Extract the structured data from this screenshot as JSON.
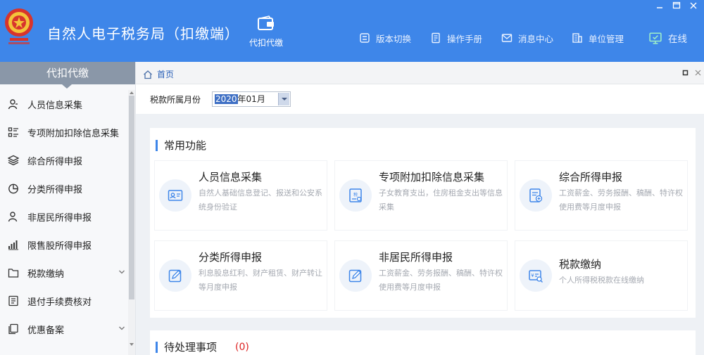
{
  "app": {
    "title": "自然人电子税务局（扣缴端）",
    "main_nav_label": "代扣代缴"
  },
  "header_menu": [
    {
      "label": "版本切换",
      "icon": "version-switch-icon"
    },
    {
      "label": "操作手册",
      "icon": "manual-icon"
    },
    {
      "label": "消息中心",
      "icon": "message-icon"
    },
    {
      "label": "单位管理",
      "icon": "company-icon"
    },
    {
      "label": "在线",
      "icon": "online-monitor-icon"
    }
  ],
  "sidebar": {
    "heading": "代扣代缴",
    "items": [
      {
        "label": "人员信息采集",
        "icon": "person-icon"
      },
      {
        "label": "专项附加扣除信息采集",
        "icon": "list-icon"
      },
      {
        "label": "综合所得申报",
        "icon": "layers-icon"
      },
      {
        "label": "分类所得申报",
        "icon": "pie-icon"
      },
      {
        "label": "非居民所得申报",
        "icon": "person-outline-icon"
      },
      {
        "label": "限售股所得申报",
        "icon": "bar-chart-icon"
      },
      {
        "label": "税款缴纳",
        "icon": "folder-icon"
      },
      {
        "label": "退付手续费核对",
        "icon": "document-icon"
      },
      {
        "label": "优惠备案",
        "icon": "copy-icon"
      }
    ]
  },
  "tabbar": {
    "home_label": "首页"
  },
  "filter": {
    "label": "税款所属月份",
    "value_year": "2020",
    "value_rest": "年01月"
  },
  "common": {
    "title": "常用功能",
    "cards": [
      {
        "title": "人员信息采集",
        "desc": "自然人基础信息登记、报送和公安系统身份验证",
        "icon": "id-card-icon"
      },
      {
        "title": "专项附加扣除信息采集",
        "desc": "子女教育支出，住房租金支出等信息采集",
        "icon": "tax-doc-icon"
      },
      {
        "title": "综合所得申报",
        "desc": "工资薪金、劳务报酬、稿酬、特许权使用费等月度申报",
        "icon": "report-add-icon"
      },
      {
        "title": "分类所得申报",
        "desc": "利息股息红利、财产租赁、财产转让等月度申报",
        "icon": "edit-icon"
      },
      {
        "title": "非居民所得申报",
        "desc": "工资薪金、劳务报酬、稿酬、特许权使用费等月度申报",
        "icon": "edit-icon"
      },
      {
        "title": "税款缴纳",
        "desc": "个人所得税税款在线缴纳",
        "icon": "payment-search-icon"
      }
    ]
  },
  "pending": {
    "title": "待处理事项",
    "count": "(0)"
  },
  "colors": {
    "header_bg": "#3e86e9",
    "sidebar_head_bg": "#8a97a8",
    "accent": "#3e86e9",
    "pending_count": "#dd2222"
  }
}
